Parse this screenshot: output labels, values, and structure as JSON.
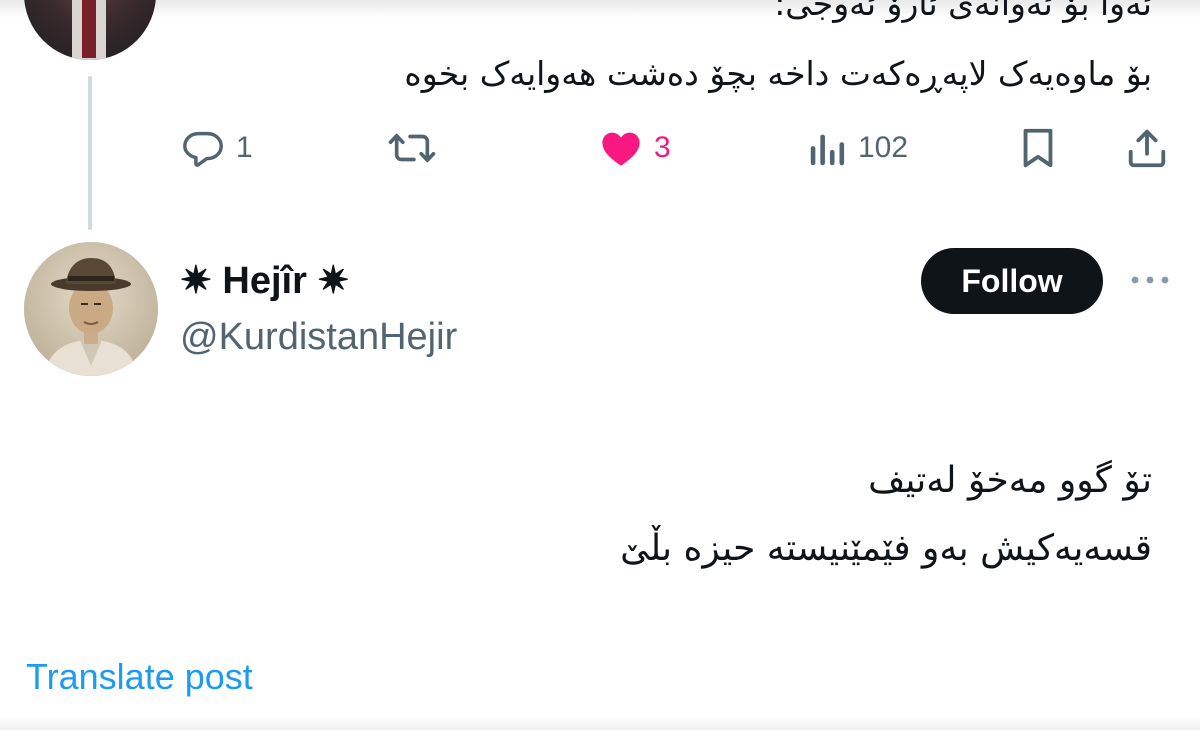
{
  "previous_post": {
    "text_line1": "ئەوا بۆ ئەوانەی ئارۆ ئەوجی:",
    "text_line2": "بۆ ماوەیەک لاپەڕەکەت داخە بچۆ دەشت هەوایەک بخوە",
    "actions": {
      "replies": "1",
      "reposts": "",
      "likes": "3",
      "views": "102"
    }
  },
  "post": {
    "author_name": "✷ Hejîr ✷",
    "author_handle": "@KurdistanHejir",
    "follow_label": "Follow",
    "text_line1": "تۆ گوو مەخۆ لەتیف",
    "text_line2": "قسەیەکیش بەو فێمێنیستە حیزە بڵێ",
    "translate_label": "Translate post"
  },
  "colors": {
    "like_accent": "#f91880",
    "link": "#1d9bf0",
    "secondary_text": "#536471",
    "follow_button": "#0f1419"
  },
  "icons": {
    "reply": "reply-icon",
    "repost": "repost-icon",
    "like": "heart-icon",
    "views": "views-icon",
    "bookmark": "bookmark-icon",
    "share": "share-icon",
    "more": "more-icon"
  }
}
